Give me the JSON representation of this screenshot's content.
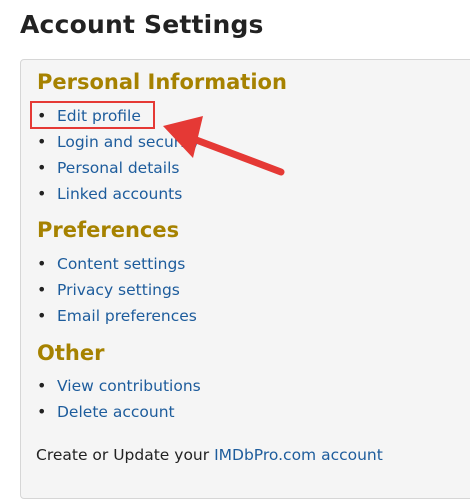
{
  "page_title": "Account Settings",
  "sections": [
    {
      "heading": "Personal Information",
      "links": [
        "Edit profile",
        "Login and security",
        "Personal details",
        "Linked accounts"
      ]
    },
    {
      "heading": "Preferences",
      "links": [
        "Content settings",
        "Privacy settings",
        "Email preferences"
      ]
    },
    {
      "heading": "Other",
      "links": [
        "View contributions",
        "Delete account"
      ]
    }
  ],
  "footer": {
    "prefix": "Create or Update your",
    "link": "IMDbPro.com account"
  },
  "annotation": {
    "highlight_color": "#e53935"
  },
  "colors": {
    "heading": "#a68200",
    "link": "#1d5c9c",
    "title": "#222222",
    "panel_background": "#f5f5f5"
  }
}
